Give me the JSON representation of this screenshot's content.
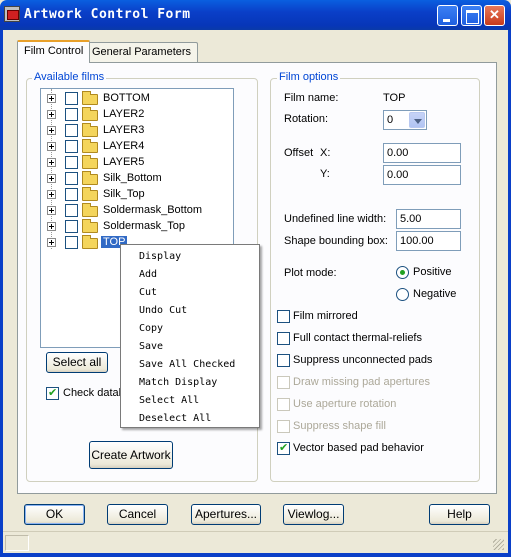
{
  "window": {
    "title": "Artwork Control Form"
  },
  "tabs": [
    {
      "label": "Film Control",
      "active": true
    },
    {
      "label": "General Parameters",
      "active": false
    }
  ],
  "available_films": {
    "label": "Available films",
    "items": [
      {
        "label": "BOTTOM",
        "checked": false,
        "selected": false
      },
      {
        "label": "LAYER2",
        "checked": false,
        "selected": false
      },
      {
        "label": "LAYER3",
        "checked": false,
        "selected": false
      },
      {
        "label": "LAYER4",
        "checked": false,
        "selected": false
      },
      {
        "label": "LAYER5",
        "checked": false,
        "selected": false
      },
      {
        "label": "Silk_Bottom",
        "checked": false,
        "selected": false
      },
      {
        "label": "Silk_Top",
        "checked": false,
        "selected": false
      },
      {
        "label": "Soldermask_Bottom",
        "checked": false,
        "selected": false
      },
      {
        "label": "Soldermask_Top",
        "checked": false,
        "selected": false
      },
      {
        "label": "TOP",
        "checked": false,
        "selected": true
      }
    ],
    "select_all_label": "Select all",
    "check_database_label": "Check datab",
    "check_database_checked": true,
    "create_artwork_label": "Create Artwork"
  },
  "context_menu": {
    "items": [
      "Display",
      "Add",
      "Cut",
      "Undo Cut",
      "Copy",
      "Save",
      "Save All Checked",
      "Match Display",
      "Select All",
      "Deselect All"
    ]
  },
  "film_options": {
    "label": "Film options",
    "film_name_label": "Film name:",
    "film_name_value": "TOP",
    "rotation_label": "Rotation:",
    "rotation_value": "0",
    "offset_label": "Offset",
    "offset_x_label": "X:",
    "offset_x_value": "0.00",
    "offset_y_label": "Y:",
    "offset_y_value": "0.00",
    "undefined_line_width_label": "Undefined line width:",
    "undefined_line_width_value": "5.00",
    "shape_bounding_box_label": "Shape bounding box:",
    "shape_bounding_box_value": "100.00",
    "plot_mode_label": "Plot mode:",
    "plot_mode_positive": "Positive",
    "plot_mode_negative": "Negative",
    "plot_mode_selected": "Positive",
    "checkboxes": [
      {
        "label": "Film mirrored",
        "checked": false,
        "enabled": true
      },
      {
        "label": "Full contact thermal-reliefs",
        "checked": false,
        "enabled": true
      },
      {
        "label": "Suppress unconnected pads",
        "checked": false,
        "enabled": true
      },
      {
        "label": "Draw missing pad apertures",
        "checked": false,
        "enabled": false
      },
      {
        "label": "Use aperture rotation",
        "checked": false,
        "enabled": false
      },
      {
        "label": "Suppress shape fill",
        "checked": false,
        "enabled": false
      },
      {
        "label": "Vector based pad behavior",
        "checked": true,
        "enabled": true
      }
    ]
  },
  "footer_buttons": {
    "ok": "OK",
    "cancel": "Cancel",
    "apertures": "Apertures...",
    "viewlog": "Viewlog...",
    "help": "Help"
  },
  "colors": {
    "titlebar": "#0a3fc8",
    "group_label": "#0046d5",
    "selection": "#316ac5",
    "check": "#21a121"
  }
}
